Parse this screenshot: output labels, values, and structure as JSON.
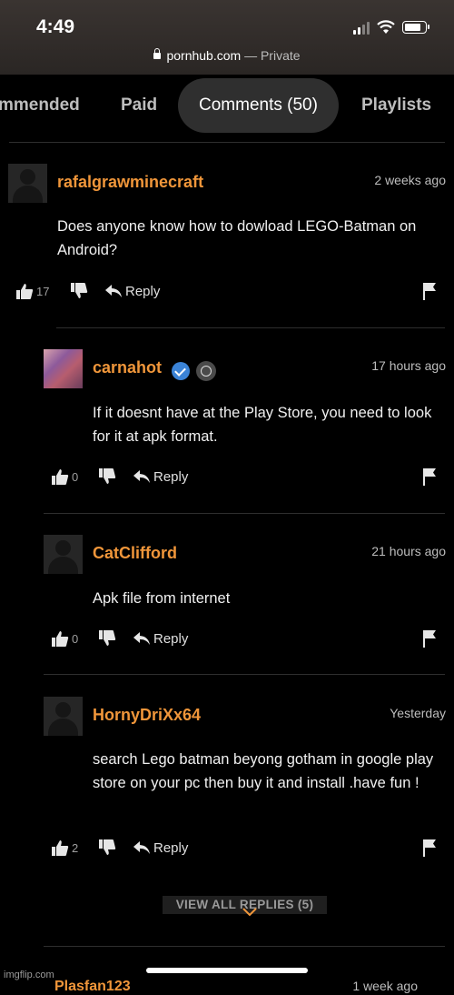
{
  "status_bar": {
    "time": "4:49"
  },
  "browser": {
    "domain": "pornhub.com",
    "mode": "— Private"
  },
  "tabs": [
    {
      "label": "mmended"
    },
    {
      "label": "Paid"
    },
    {
      "label": "Comments (50)"
    },
    {
      "label": "Playlists"
    }
  ],
  "comments": [
    {
      "username": "rafalgrawminecraft",
      "time": "2 weeks ago",
      "body": "Does anyone know how to dowload LEGO-Batman on Android?",
      "likes": "17",
      "reply_label": "Reply"
    },
    {
      "username": "carnahot",
      "time": "17 hours ago",
      "body": "If it doesnt have at the Play Store, you need to look for it at apk format.",
      "likes": "0",
      "reply_label": "Reply"
    },
    {
      "username": "CatClifford",
      "time": "21 hours ago",
      "body": "Apk file from internet",
      "likes": "0",
      "reply_label": "Reply"
    },
    {
      "username": "HornyDriXx64",
      "time": "Yesterday",
      "body": "search Lego batman beyong gotham in google play store on your pc then buy it and install .have fun !",
      "likes": "2",
      "reply_label": "Reply"
    }
  ],
  "view_all_replies": "VIEW ALL REPLIES (5)",
  "peek": {
    "username": "Plasfan123",
    "time": "1 week ago"
  },
  "watermark": "imgflip.com",
  "colors": {
    "username": "#f0963a",
    "background": "#000000",
    "active_tab": "#2f2f2f",
    "verified": "#3b83d6"
  }
}
